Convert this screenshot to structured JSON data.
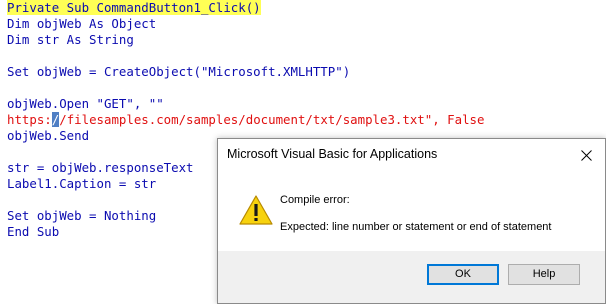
{
  "editor": {
    "lines": [
      {
        "text": "Private Sub CommandButton1_Click()",
        "style": "highlight"
      },
      {
        "text": "Dim objWeb As Object",
        "style": "normal"
      },
      {
        "text": "Dim str As String",
        "style": "normal"
      },
      {
        "text": "",
        "style": "normal"
      },
      {
        "text": "Set objWeb = CreateObject(\"Microsoft.XMLHTTP\")",
        "style": "normal"
      },
      {
        "text": "",
        "style": "normal"
      },
      {
        "text": "objWeb.Open \"GET\", \"\"",
        "style": "normal"
      },
      {
        "text_before": "https:",
        "text_selected": "/",
        "text_after": "/filesamples.com/samples/document/txt/sample3.txt\", False",
        "style": "error"
      },
      {
        "text": "objWeb.Send",
        "style": "normal"
      },
      {
        "text": "",
        "style": "normal"
      },
      {
        "text": "str = objWeb.responseText",
        "style": "normal"
      },
      {
        "text": "Label1.Caption = str",
        "style": "normal"
      },
      {
        "text": "",
        "style": "normal"
      },
      {
        "text": "Set objWeb = Nothing",
        "style": "normal"
      },
      {
        "text": "End Sub",
        "style": "normal"
      }
    ],
    "colors": {
      "code": "#0b0bb0",
      "error": "#e01010",
      "highlight": "#ffff55",
      "selection": "#4f7fc4"
    }
  },
  "dialog": {
    "title": "Microsoft Visual Basic for Applications",
    "close_icon": "close-icon",
    "icon": "warning-icon",
    "message_title": "Compile error:",
    "message_body": "Expected: line number or statement or end of statement",
    "buttons": {
      "ok": "OK",
      "help": "Help"
    },
    "colors": {
      "default_button_border": "#0078d7",
      "button_bar": "#f0f0f0"
    }
  }
}
